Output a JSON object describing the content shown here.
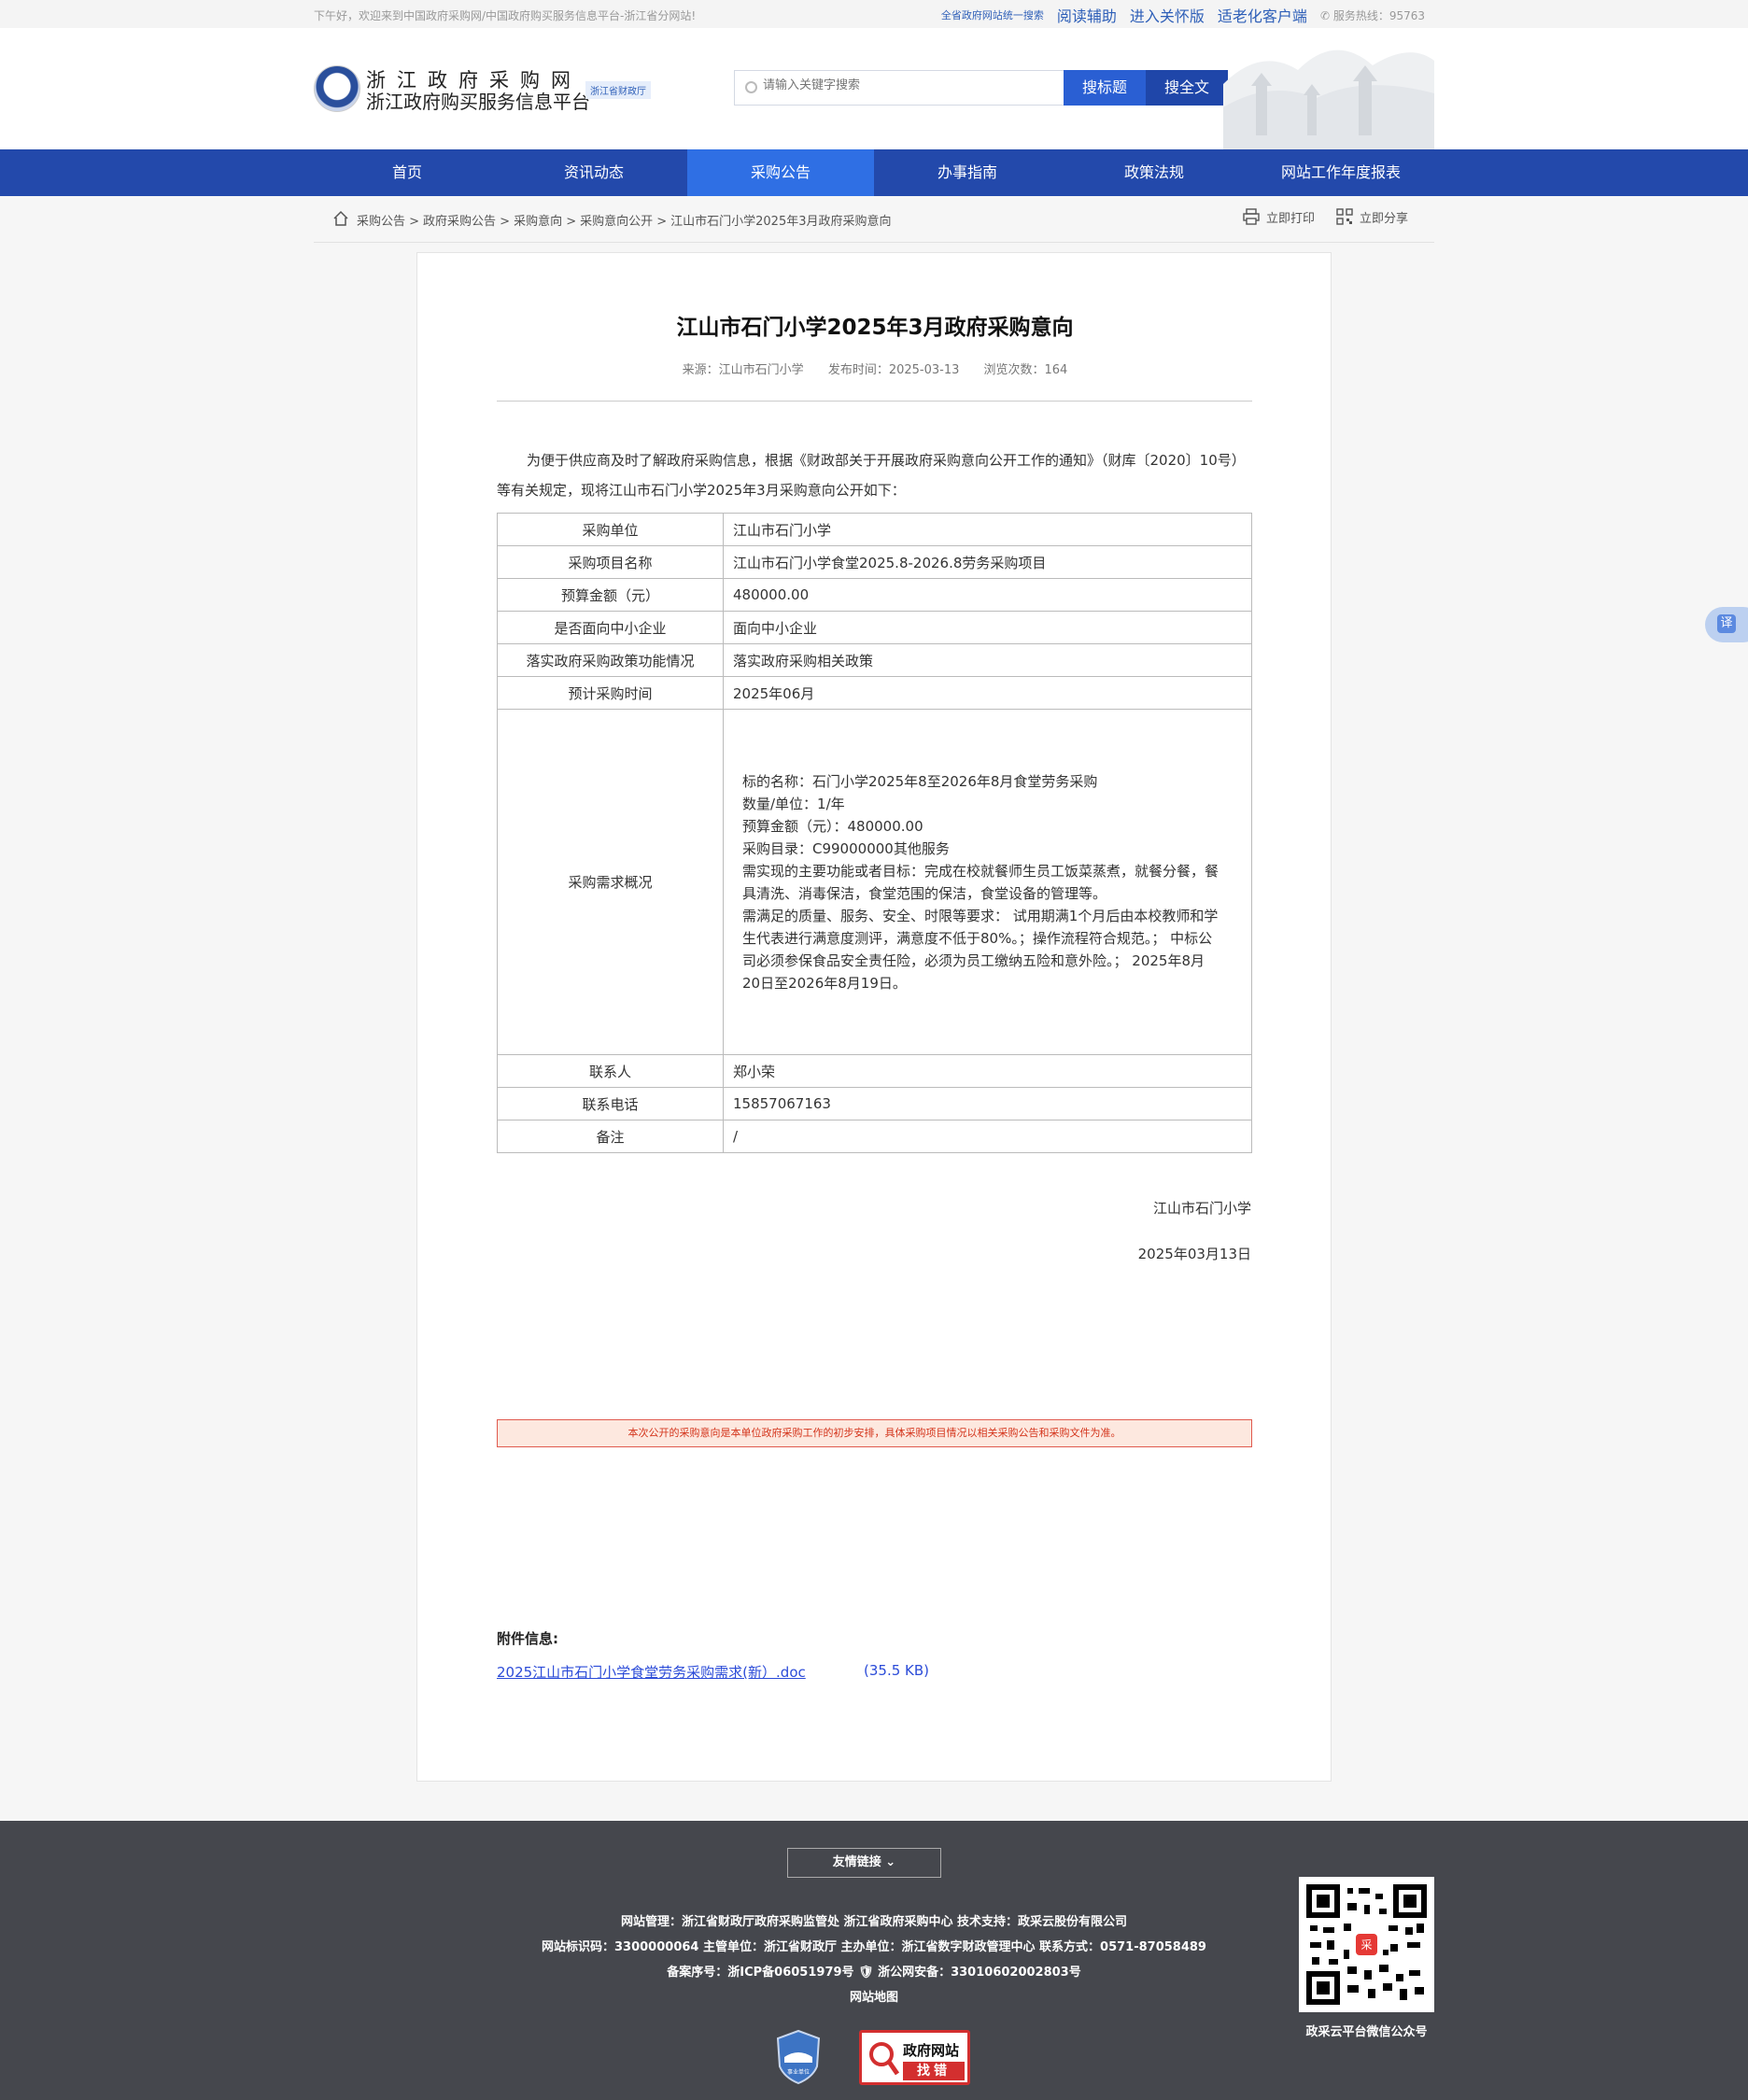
{
  "topbar": {
    "greeting": "下午好，欢迎来到中国政府采购网/中国政府购买服务信息平台-浙江省分网站!",
    "unified_search": "全省政府网站统一搜索",
    "reading_aid": "阅读辅助",
    "care_version": "进入关怀版",
    "elder_client": "适老化客户端",
    "hotline": "服务热线：95763"
  },
  "header": {
    "site_name_1": "浙江政府采购网",
    "site_name_2": "浙江政府购买服务信息平台",
    "tag": "浙江省财政厅",
    "search_placeholder": "请输入关键字搜索",
    "search_title_btn": "搜标题",
    "search_full_btn": "搜全文"
  },
  "nav": [
    "首页",
    "资讯动态",
    "采购公告",
    "办事指南",
    "政策法规",
    "网站工作年度报表"
  ],
  "breadcrumb": {
    "items": [
      "采购公告 >",
      "政府采购公告 >",
      "采购意向 >",
      "采购意向公开 >",
      "江山市石门小学2025年3月政府采购意向"
    ],
    "print": "立即打印",
    "share": "立即分享"
  },
  "article": {
    "title": "江山市石门小学2025年3月政府采购意向",
    "source": "来源：江山市石门小学",
    "publish_time": "发布时间：2025-03-13",
    "views": "浏览次数：164",
    "intro": "为便于供应商及时了解政府采购信息，根据《财政部关于开展政府采购意向公开工作的通知》（财库〔2020〕10号）等有关规定，现将江山市石门小学2025年3月采购意向公开如下：",
    "rows": [
      {
        "k": "采购单位",
        "v": "江山市石门小学"
      },
      {
        "k": "采购项目名称",
        "v": "江山市石门小学食堂2025.8-2026.8劳务采购项目"
      },
      {
        "k": "预算金额（元）",
        "v": "480000.00"
      },
      {
        "k": "是否面向中小企业",
        "v": "面向中小企业"
      },
      {
        "k": "落实政府采购政策功能情况",
        "v": "落实政府采购相关政策"
      },
      {
        "k": "预计采购时间",
        "v": "2025年06月"
      }
    ],
    "requirement_key": "采购需求概况",
    "requirement_lines": [
      "标的名称：石门小学2025年8至2026年8月食堂劳务采购",
      "数量/单位：1/年",
      "预算金额（元）：480000.00",
      "采购目录：C99000000其他服务",
      "需实现的主要功能或者目标：完成在校就餐师生员工饭菜蒸煮，就餐分餐，餐具清洗、消毒保洁，食堂范围的保洁，食堂设备的管理等。",
      "需满足的质量、服务、安全、时限等要求： 试用期满1个月后由本校教师和学生代表进行满意度测评，满意度不低于80%。；操作流程符合规范。； 中标公司必须参保食品安全责任险，必须为员工缴纳五险和意外险。； 2025年8月20日至2026年8月19日。"
    ],
    "rows_after": [
      {
        "k": "联系人",
        "v": "郑小荣"
      },
      {
        "k": "联系电话",
        "v": "15857067163"
      },
      {
        "k": "备注",
        "v": "/"
      }
    ],
    "signature": "江山市石门小学",
    "date": "2025年03月13日",
    "notice": "本次公开的采购意向是本单位政府采购工作的初步安排，具体采购项目情况以相关采购公告和采购文件为准。",
    "attachment_heading": "附件信息:",
    "attachment_name": "2025江山市石门小学食堂劳务采购需求(新）.doc",
    "attachment_size": "(35.5 KB)"
  },
  "translate_label": "译",
  "footer": {
    "friend_links": "友情链接 ⌄",
    "line1": "网站管理：浙江省财政厅政府采购监管处 浙江省政府采购中心 技术支持：政采云股份有限公司",
    "line2": "网站标识码：3300000064 主管单位：浙江省财政厅 主办单位：浙江省数字财政管理中心 联系方式：0571-87058489",
    "line3": "备案序号：浙ICP备06051979号 🛡 浙公网安备：33010602002803号",
    "sitemap": "网站地图",
    "qr_caption": "政采云平台微信公众号",
    "badge1_text": "事业单位",
    "badge2_t1": "政府网站",
    "badge2_t2": "找错"
  },
  "colors": {
    "nav_bg": "#2349ab",
    "nav_active": "#2f6fe4",
    "link": "#2b4bd8",
    "footer_bg": "#45474d",
    "notice_border": "#e05a4e"
  }
}
